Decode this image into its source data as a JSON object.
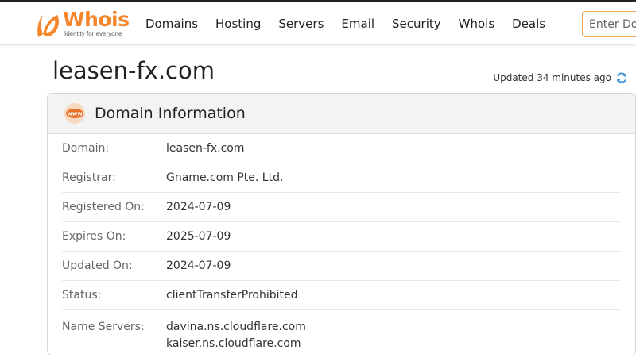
{
  "brand": {
    "name": "Whois",
    "tagline": "Identity for everyone",
    "accent_color": "#f5862b"
  },
  "nav": {
    "items": [
      "Domains",
      "Hosting",
      "Servers",
      "Email",
      "Security",
      "Whois",
      "Deals"
    ]
  },
  "search": {
    "placeholder": "Enter Domain or IP"
  },
  "page": {
    "title": "leasen-fx.com",
    "updated": "Updated 34 minutes ago"
  },
  "domain_info": {
    "heading": "Domain Information",
    "icon": "www-icon",
    "rows": [
      {
        "label": "Domain:",
        "value": "leasen-fx.com"
      },
      {
        "label": "Registrar:",
        "value": "Gname.com Pte. Ltd."
      },
      {
        "label": "Registered On:",
        "value": "2024-07-09"
      },
      {
        "label": "Expires On:",
        "value": "2025-07-09"
      },
      {
        "label": "Updated On:",
        "value": "2024-07-09"
      },
      {
        "label": "Status:",
        "value": "clientTransferProhibited"
      }
    ],
    "name_servers": {
      "label": "Name Servers:",
      "values": [
        "davina.ns.cloudflare.com",
        "kaiser.ns.cloudflare.com"
      ]
    }
  }
}
